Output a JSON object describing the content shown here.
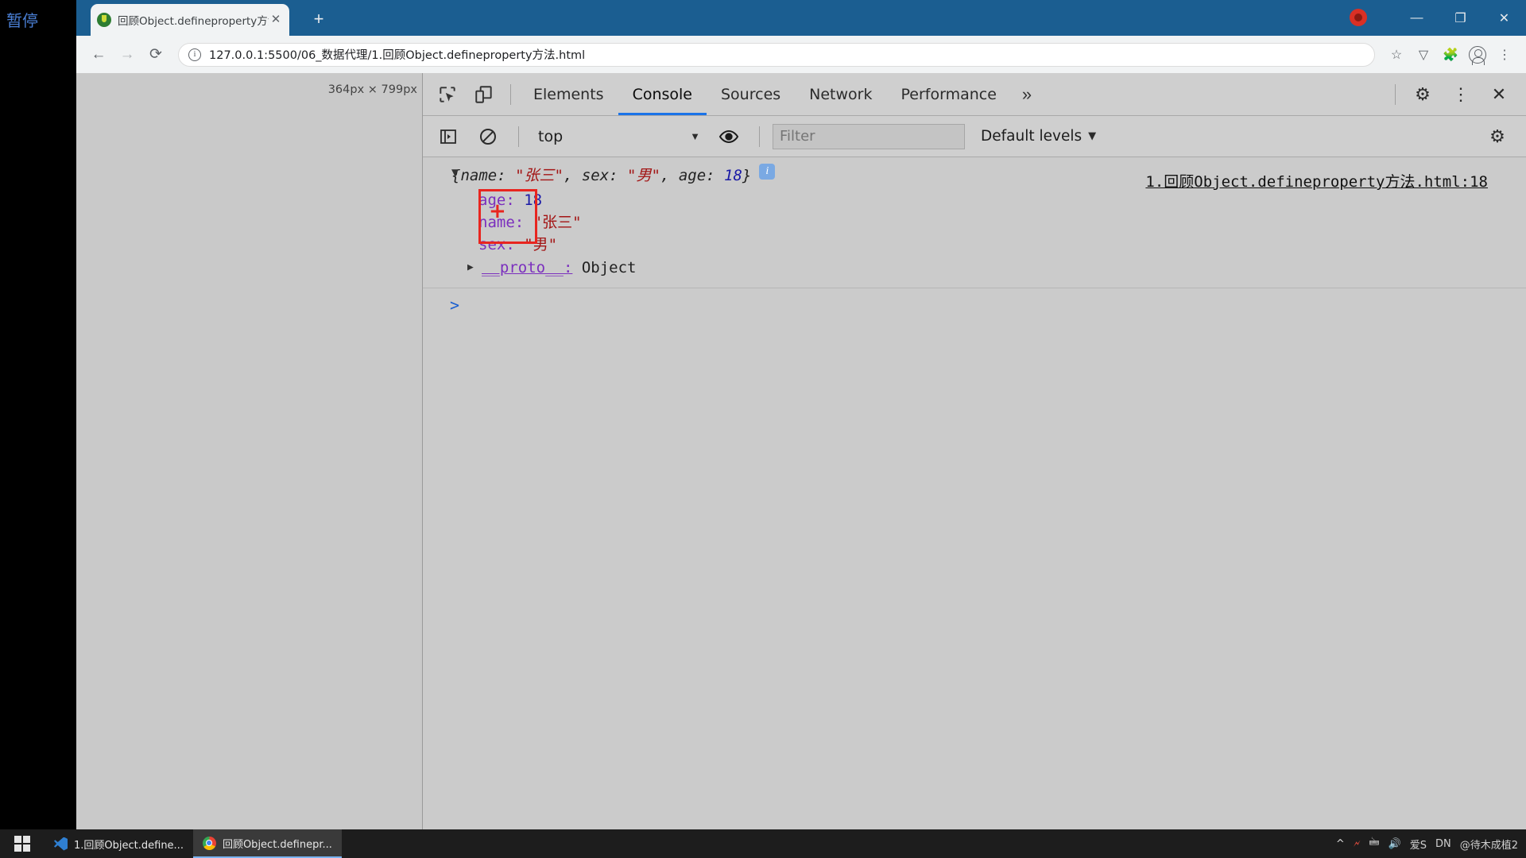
{
  "desktop": {
    "left_label": "暂停"
  },
  "browser": {
    "tab": {
      "title": "回顾Object.defineproperty方法",
      "close_label": "✕",
      "favicon_name": "site-favicon"
    },
    "new_tab_label": "+",
    "window_controls": {
      "minimize": "—",
      "maximize": "❐",
      "close": "✕"
    },
    "toolbar": {
      "back_label": "←",
      "forward_label": "→",
      "reload_label": "⟳",
      "info_label": "i",
      "url": "127.0.0.1:5500/06_数据代理/1.回顾Object.defineproperty方法.html",
      "bookmark_label": "☆",
      "extension1_label": "▽",
      "extension2_label": "🧩",
      "menu_label": "⋮"
    }
  },
  "page_pane": {
    "size_badge": "364px × 799px"
  },
  "devtools": {
    "inspect_icon": "inspect-element-icon",
    "device_icon": "device-toolbar-icon",
    "tabs": [
      {
        "label": "Elements",
        "active": false
      },
      {
        "label": "Console",
        "active": true
      },
      {
        "label": "Sources",
        "active": false
      },
      {
        "label": "Network",
        "active": false
      },
      {
        "label": "Performance",
        "active": false
      }
    ],
    "more_tabs_label": "»",
    "settings_label": "⚙",
    "kebab_label": "⋮",
    "close_label": "✕",
    "filterbar": {
      "sidebar_toggle_name": "console-sidebar-toggle",
      "clear_label": "⊘",
      "context": "top",
      "context_caret": "▼",
      "eye_name": "live-expression-eye-icon",
      "filter_placeholder": "Filter",
      "filter_value": "",
      "levels_label": "Default levels",
      "levels_caret": "▼",
      "settings_label": "⚙"
    },
    "console": {
      "message": {
        "disclosure": "▼",
        "preview_open": "{name: ",
        "preview_name_value": "\"张三\"",
        "preview_mid1": ", sex: ",
        "preview_sex_value": "\"男\"",
        "preview_mid2": ", age: ",
        "preview_age_value": "18",
        "preview_close": "}",
        "info_badge": "i",
        "source_link": "1.回顾Object.defineproperty方法.html:18",
        "properties": [
          {
            "key": "age:",
            "value": "18",
            "type": "number"
          },
          {
            "key": "name:",
            "value": "\"张三\"",
            "type": "string"
          },
          {
            "key": "sex:",
            "value": "\"男\"",
            "type": "string"
          }
        ],
        "proto": {
          "arrow": "▶",
          "key": "__proto__:",
          "value": "Object"
        }
      },
      "prompt_caret": ">"
    }
  },
  "taskbar": {
    "start_name": "start-button",
    "items": [
      {
        "label": "1.回顾Object.define...",
        "icon": "vscode-icon",
        "active": false
      },
      {
        "label": "回顾Object.definepr...",
        "icon": "chrome-icon",
        "active": true
      }
    ],
    "tray": {
      "chevron": "^",
      "icons": [
        "🗲",
        "🖮",
        "🔊"
      ],
      "watermark_a": "爱S",
      "watermark_b": "DN",
      "watermark_c": "@待木成植2"
    }
  },
  "colors": {
    "accent_blue": "#1a73e8",
    "annotation_red": "#e8251f",
    "string_red": "#a31515",
    "number_blue": "#1a1aa6",
    "key_purple": "#7b2fbe",
    "titlebar_blue": "#1b5e91"
  }
}
